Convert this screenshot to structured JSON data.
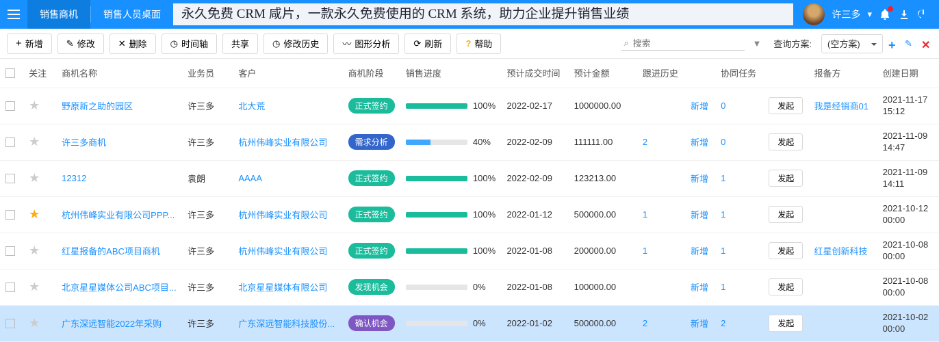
{
  "header": {
    "tab_active": "销售商机",
    "tab_other": "销售人员桌面",
    "banner": "永久免费 CRM 咸片，一款永久免费使用的 CRM 系统，助力企业提升销售业绩",
    "user": "许三多"
  },
  "toolbar": {
    "add": "新增",
    "edit": "修改",
    "del": "删除",
    "timeline": "时间轴",
    "share": "共享",
    "history": "修改历史",
    "chart": "图形分析",
    "refresh": "刷新",
    "help": "帮助",
    "search_placeholder": "搜索",
    "plan_label": "查询方案:",
    "plan_value": "(空方案)"
  },
  "columns": {
    "follow": "关注",
    "name": "商机名称",
    "agent": "业务员",
    "customer": "客户",
    "stage": "商机阶段",
    "progress": "销售进度",
    "expect_date": "预计成交时间",
    "expect_amount": "预计金额",
    "follow_history": "跟进历史",
    "coop_task": "协同任务",
    "reporter": "报备方",
    "create_date": "创建日期"
  },
  "btn_new": "新增",
  "btn_initiate": "发起",
  "rows": [
    {
      "star": false,
      "name": "野原新之助的园区",
      "agent": "许三多",
      "customer": "北大荒",
      "stage": "正式签约",
      "stage_cls": "stage-green",
      "progress": 100,
      "p_cls": "",
      "expect_date": "2022-02-17",
      "expect_amount": "1000000.00",
      "follow_history": "",
      "coop": "0",
      "reporter": "我是经销商01",
      "create_date": "2021-11-17",
      "create_time": "15:12"
    },
    {
      "star": false,
      "name": "许三多商机",
      "agent": "许三多",
      "customer": "杭州伟峰实业有限公司",
      "stage": "需求分析",
      "stage_cls": "stage-blue",
      "progress": 40,
      "p_cls": "blue",
      "expect_date": "2022-02-09",
      "expect_amount": "111111.00",
      "follow_history": "2",
      "coop": "0",
      "reporter": "",
      "create_date": "2021-11-09",
      "create_time": "14:47"
    },
    {
      "star": false,
      "name": "12312",
      "agent": "袁朗",
      "customer": "AAAA",
      "stage": "正式签约",
      "stage_cls": "stage-green",
      "progress": 100,
      "p_cls": "",
      "expect_date": "2022-02-09",
      "expect_amount": "123213.00",
      "follow_history": "",
      "coop": "1",
      "reporter": "",
      "create_date": "2021-11-09",
      "create_time": "14:11"
    },
    {
      "star": true,
      "name": "杭州伟峰实业有限公司PPP...",
      "agent": "许三多",
      "customer": "杭州伟峰实业有限公司",
      "stage": "正式签约",
      "stage_cls": "stage-green",
      "progress": 100,
      "p_cls": "",
      "expect_date": "2022-01-12",
      "expect_amount": "500000.00",
      "follow_history": "1",
      "coop": "1",
      "reporter": "",
      "create_date": "2021-10-12",
      "create_time": "00:00"
    },
    {
      "star": false,
      "name": "红星报备的ABC项目商机",
      "agent": "许三多",
      "customer": "杭州伟峰实业有限公司",
      "stage": "正式签约",
      "stage_cls": "stage-green",
      "progress": 100,
      "p_cls": "",
      "expect_date": "2022-01-08",
      "expect_amount": "200000.00",
      "follow_history": "1",
      "coop": "1",
      "reporter": "红星创新科技",
      "create_date": "2021-10-08",
      "create_time": "00:00"
    },
    {
      "star": false,
      "name": "北京星星媒体公司ABC项目...",
      "agent": "许三多",
      "customer": "北京星星媒体有限公司",
      "stage": "发现机会",
      "stage_cls": "stage-green",
      "progress": 0,
      "p_cls": "",
      "expect_date": "2022-01-08",
      "expect_amount": "100000.00",
      "follow_history": "",
      "coop": "1",
      "reporter": "",
      "create_date": "2021-10-08",
      "create_time": "00:00"
    },
    {
      "star": false,
      "selected": true,
      "name": "广东深远智能2022年采购",
      "agent": "许三多",
      "customer": "广东深远智能科技股份...",
      "stage": "确认机会",
      "stage_cls": "stage-purple",
      "progress": 0,
      "p_cls": "",
      "expect_date": "2022-01-02",
      "expect_amount": "500000.00",
      "follow_history": "2",
      "coop": "2",
      "reporter": "",
      "create_date": "2021-10-02",
      "create_time": "00:00"
    }
  ]
}
